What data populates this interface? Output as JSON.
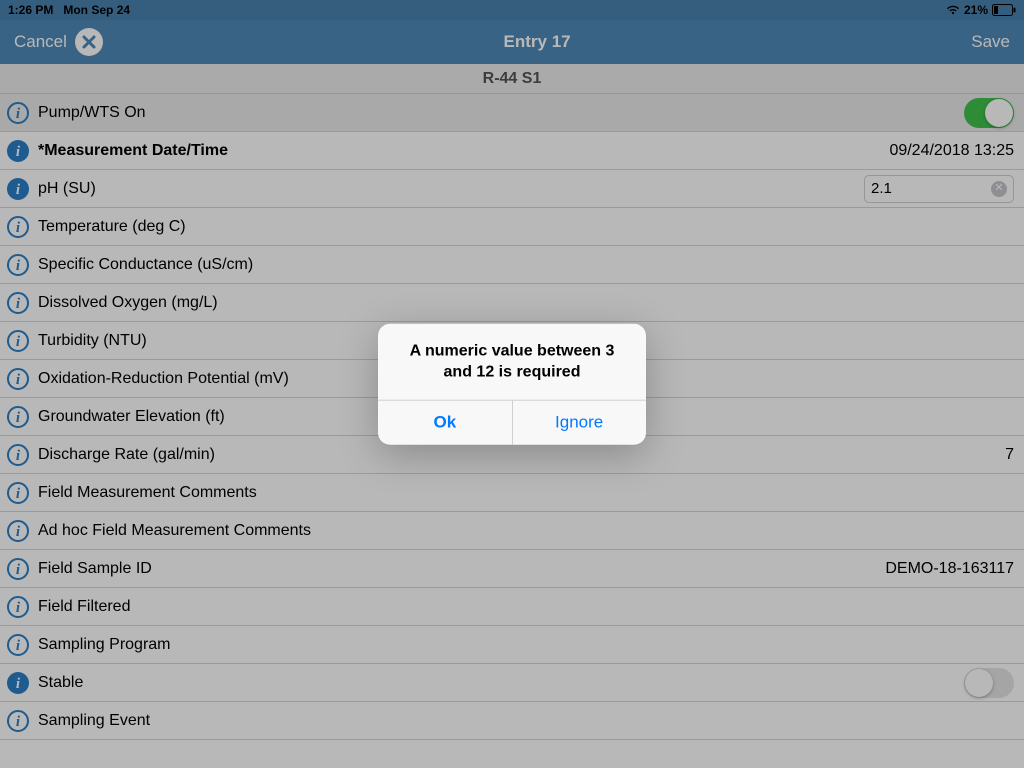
{
  "status": {
    "time": "1:26 PM",
    "date": "Mon Sep 24",
    "battery_pct": "21%"
  },
  "nav": {
    "cancel": "Cancel",
    "title": "Entry 17",
    "save": "Save"
  },
  "subheader": "R-44 S1",
  "rows": {
    "pump": {
      "label": "Pump/WTS On",
      "toggle": true
    },
    "mdate": {
      "label": "*Measurement Date/Time",
      "value": "09/24/2018 13:25"
    },
    "ph": {
      "label": "pH (SU)",
      "value": "2.1"
    },
    "temp": {
      "label": "Temperature (deg C)"
    },
    "spc": {
      "label": "Specific Conductance (uS/cm)"
    },
    "do": {
      "label": "Dissolved Oxygen (mg/L)"
    },
    "turb": {
      "label": "Turbidity (NTU)"
    },
    "orp": {
      "label": "Oxidation-Reduction Potential (mV)"
    },
    "gwe": {
      "label": "Groundwater Elevation (ft)"
    },
    "discharge": {
      "label": "Discharge Rate (gal/min)",
      "value": "7"
    },
    "fmc": {
      "label": "Field Measurement Comments"
    },
    "ahfmc": {
      "label": "Ad hoc Field Measurement Comments"
    },
    "fsid": {
      "label": "Field Sample ID",
      "value": "DEMO-18-163117"
    },
    "ff": {
      "label": "Field Filtered"
    },
    "sprog": {
      "label": "Sampling Program"
    },
    "stable": {
      "label": "Stable",
      "toggle": false
    },
    "sevent": {
      "label": "Sampling Event"
    }
  },
  "alert": {
    "message": "A numeric value between 3 and 12 is required",
    "ok": "Ok",
    "ignore": "Ignore"
  }
}
